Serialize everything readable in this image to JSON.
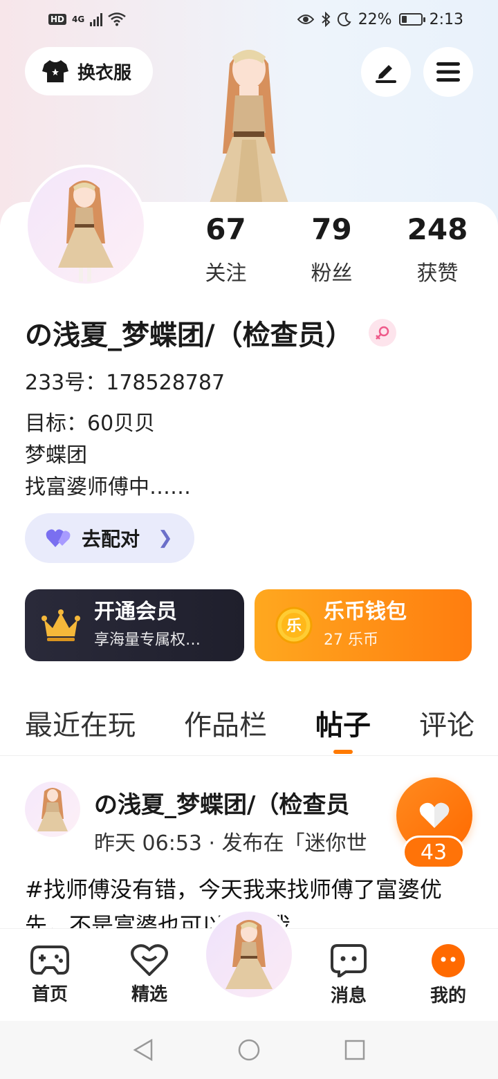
{
  "status_bar": {
    "network": "4G",
    "battery": "22%",
    "time": "2:13",
    "icons": [
      "hd-icon",
      "signal-icon",
      "wifi-icon",
      "eye-icon",
      "bluetooth-icon",
      "moon-icon",
      "battery-icon"
    ]
  },
  "header": {
    "outfit_label": "换衣服",
    "edit_icon": "pen-icon",
    "menu_icon": "hamburger-icon"
  },
  "stats": [
    {
      "value": "67",
      "label": "关注"
    },
    {
      "value": "79",
      "label": "粉丝"
    },
    {
      "value": "248",
      "label": "获赞"
    }
  ],
  "profile": {
    "username": "の浅夏_梦蝶团/（检查员）",
    "uid": "233号：178528787",
    "bio": [
      "目标：60贝贝",
      "梦蝶团",
      "找富婆师傅中……"
    ]
  },
  "match": {
    "label": "去配对"
  },
  "vip": {
    "title": "开通会员",
    "subtitle": "享海量专属权…"
  },
  "wallet": {
    "title": "乐币钱包",
    "subtitle": "27 乐币",
    "coin_text": "乐"
  },
  "tabs": [
    {
      "label": "最近在玩",
      "active": false
    },
    {
      "label": "作品栏",
      "active": false
    },
    {
      "label": "帖子",
      "active": true
    },
    {
      "label": "评论",
      "active": false
    }
  ],
  "post": {
    "author": "の浅夏_梦蝶团/（检查员",
    "meta": "昨天 06:53 · 发布在「迷你世",
    "text": "#找师傅没有错，今天我来找师傅了富婆优先，不是富婆也可以的自我"
  },
  "like": {
    "count": "43"
  },
  "bottom_nav": [
    {
      "label": "首页",
      "icon": "gamepad-icon"
    },
    {
      "label": "精选",
      "icon": "heart-smile-icon"
    },
    {
      "label": "消息",
      "icon": "chat-icon"
    },
    {
      "label": "我的",
      "icon": "face-icon"
    }
  ],
  "colors": {
    "accent": "#ff7a00",
    "vip_bg": "#2a2a3a",
    "wallet_bg": "#ff8c14",
    "match_bg": "#e9ebfb"
  }
}
